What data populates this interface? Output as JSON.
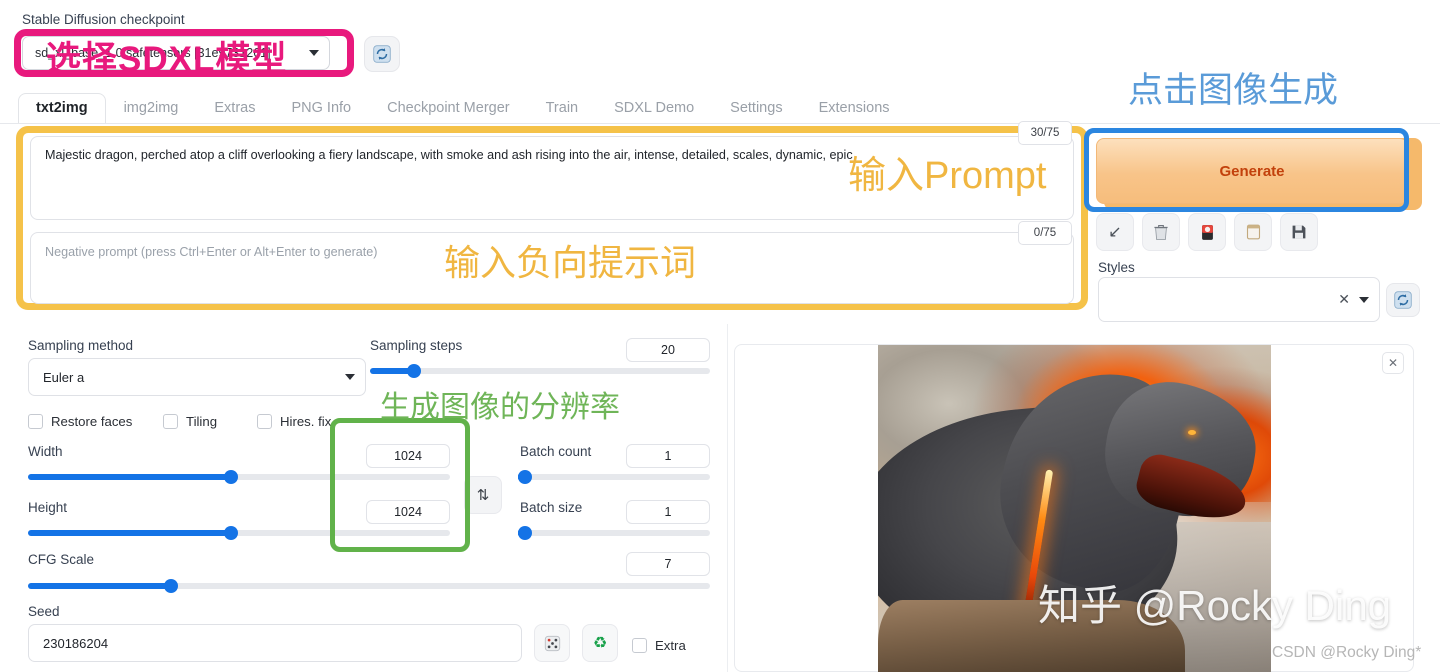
{
  "checkpoint": {
    "label": "Stable Diffusion checkpoint",
    "value": "sd_xl_base_1.0.safetensors [31e9731261]",
    "refresh_icon": "refresh-icon",
    "dropdown_icon": "chevron-down-icon"
  },
  "annotations": {
    "checkpoint_note": "选择SDXL模型",
    "checkpoint_note_color": "#e8197d",
    "prompt_note": "输入Prompt",
    "negative_note": "输入负向提示词",
    "prompt_note_color": "#f0b641",
    "generate_note": "点击图像生成",
    "generate_note_color": "#5a9bd8",
    "resolution_note": "生成图像的分辨率",
    "resolution_note_color": "#6fb558"
  },
  "tabs": [
    {
      "label": "txt2img",
      "active": true
    },
    {
      "label": "img2img",
      "active": false
    },
    {
      "label": "Extras",
      "active": false
    },
    {
      "label": "PNG Info",
      "active": false
    },
    {
      "label": "Checkpoint Merger",
      "active": false
    },
    {
      "label": "Train",
      "active": false
    },
    {
      "label": "SDXL Demo",
      "active": false
    },
    {
      "label": "Settings",
      "active": false
    },
    {
      "label": "Extensions",
      "active": false
    }
  ],
  "prompt": {
    "value": "Majestic dragon, perched atop a cliff overlooking a fiery landscape, with smoke and ash rising into the air, intense, detailed, scales, dynamic, epic",
    "token_count": "30/75"
  },
  "negative_prompt": {
    "placeholder": "Negative prompt (press Ctrl+Enter or Alt+Enter to generate)",
    "value": "",
    "token_count": "0/75"
  },
  "generate": {
    "label": "Generate"
  },
  "toolbar_icons": [
    {
      "name": "arrow-down-left-icon",
      "glyph": "↙"
    },
    {
      "name": "trash-icon",
      "glyph": "🗑"
    },
    {
      "name": "paintbrush-card-icon",
      "glyph": "🎴"
    },
    {
      "name": "clipboard-icon",
      "glyph": "🗒"
    },
    {
      "name": "save-floppy-icon",
      "glyph": "💾"
    }
  ],
  "styles": {
    "label": "Styles",
    "value": "",
    "clear_icon": "close-x-icon",
    "dropdown_icon": "chevron-down-icon",
    "refresh_icon": "refresh-icon"
  },
  "settings": {
    "sampling_method": {
      "label": "Sampling method",
      "value": "Euler a"
    },
    "sampling_steps": {
      "label": "Sampling steps",
      "value": "20",
      "fill_pct": 13
    },
    "checkboxes": [
      {
        "label": "Restore faces",
        "checked": false
      },
      {
        "label": "Tiling",
        "checked": false
      },
      {
        "label": "Hires. fix",
        "checked": false
      }
    ],
    "width": {
      "label": "Width",
      "value": "1024",
      "fill_pct": 48
    },
    "height": {
      "label": "Height",
      "value": "1024",
      "fill_pct": 48
    },
    "swap_icon": "swap-vertical-icon",
    "batch_count": {
      "label": "Batch count",
      "value": "1",
      "fill_pct": 1
    },
    "batch_size": {
      "label": "Batch size",
      "value": "1",
      "fill_pct": 1
    },
    "cfg_scale": {
      "label": "CFG Scale",
      "value": "7",
      "fill_pct": 21
    },
    "seed": {
      "label": "Seed",
      "value": "230186204"
    },
    "seed_buttons": [
      {
        "name": "dice-randomize-icon",
        "glyph": "🎲"
      },
      {
        "name": "recycle-reuse-seed-icon",
        "glyph": "♻"
      }
    ],
    "extra_checkbox": {
      "label": "Extra",
      "checked": false
    }
  },
  "image_panel": {
    "close_icon": "close-x-icon",
    "watermark_primary": "知乎 @Rocky Ding",
    "watermark_secondary": "CSDN @Rocky Ding*"
  }
}
